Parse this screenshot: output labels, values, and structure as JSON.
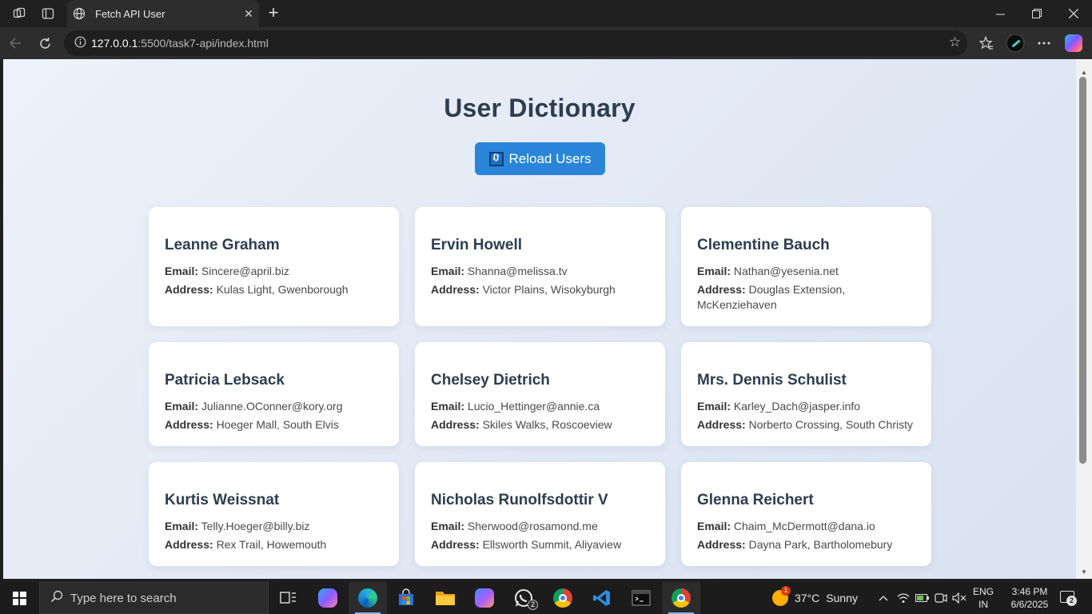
{
  "browser": {
    "tab_title": "Fetch API User",
    "url_host": "127.0.0.1",
    "url_rest": ":5500/task7-api/index.html"
  },
  "page": {
    "title": "User Dictionary",
    "reload_label": "Reload Users",
    "email_label": "Email:",
    "address_label": "Address:",
    "users": [
      {
        "name": "Leanne Graham",
        "email": "Sincere@april.biz",
        "address": "Kulas Light, Gwenborough"
      },
      {
        "name": "Ervin Howell",
        "email": "Shanna@melissa.tv",
        "address": "Victor Plains, Wisokyburgh"
      },
      {
        "name": "Clementine Bauch",
        "email": "Nathan@yesenia.net",
        "address": "Douglas Extension, McKenziehaven"
      },
      {
        "name": "Patricia Lebsack",
        "email": "Julianne.OConner@kory.org",
        "address": "Hoeger Mall, South Elvis"
      },
      {
        "name": "Chelsey Dietrich",
        "email": "Lucio_Hettinger@annie.ca",
        "address": "Skiles Walks, Roscoeview"
      },
      {
        "name": "Mrs. Dennis Schulist",
        "email": "Karley_Dach@jasper.info",
        "address": "Norberto Crossing, South Christy"
      },
      {
        "name": "Kurtis Weissnat",
        "email": "Telly.Hoeger@billy.biz",
        "address": "Rex Trail, Howemouth"
      },
      {
        "name": "Nicholas Runolfsdottir V",
        "email": "Sherwood@rosamond.me",
        "address": "Ellsworth Summit, Aliyaview"
      },
      {
        "name": "Glenna Reichert",
        "email": "Chaim_McDermott@dana.io",
        "address": "Dayna Park, Bartholomebury"
      }
    ]
  },
  "taskbar": {
    "search_placeholder": "Type here to search",
    "weather_alert_count": "1",
    "temperature": "37°C",
    "condition": "Sunny",
    "lang_top": "ENG",
    "lang_bottom": "IN",
    "time": "3:46 PM",
    "date": "6/6/2025",
    "whatsapp_badge": "2",
    "notification_count": "2"
  },
  "colors": {
    "accent_button": "#2a85d8",
    "heading": "#2c3e50",
    "page_bg": "#e3eaf5"
  }
}
